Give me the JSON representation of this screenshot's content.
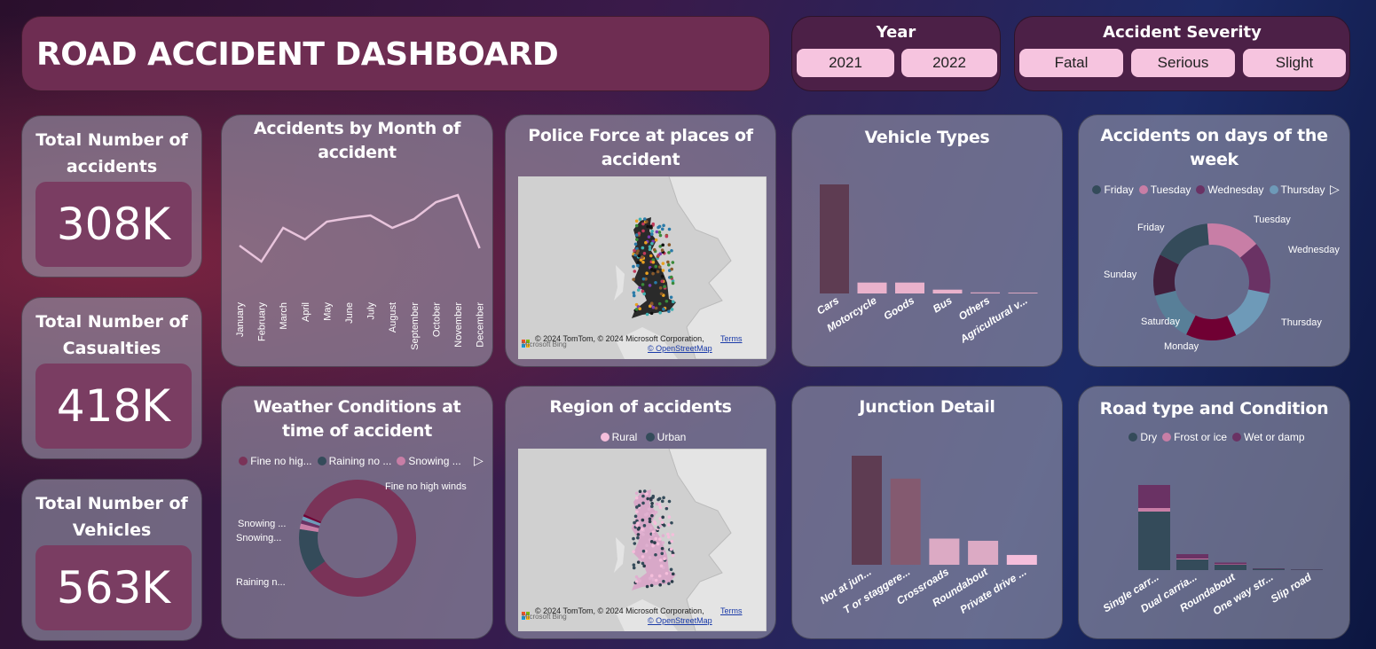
{
  "header": {
    "title": "ROAD ACCIDENT DASHBOARD"
  },
  "year_slicer": {
    "label": "Year",
    "options": [
      "2021",
      "2022"
    ]
  },
  "severity_slicer": {
    "label": "Accident Severity",
    "options": [
      "Fatal",
      "Serious",
      "Slight"
    ]
  },
  "kpis": [
    {
      "label": "Total Number of accidents",
      "value": "308K"
    },
    {
      "label": "Total Number of Casualties",
      "value": "418K"
    },
    {
      "label": "Total Number of Vehicles",
      "value": "563K"
    }
  ],
  "colors": {
    "line": "#e8c4dc",
    "dark_slate": "#344b5a",
    "pink": "#c87ea6",
    "purple": "#6a3264",
    "blue": "#6e9ab8",
    "maroon": "#700033",
    "plum": "#421e3c",
    "steel": "#587f98",
    "wine": "#7a3358",
    "light_pink": "#f5bedb"
  },
  "chart_data": [
    {
      "type": "line",
      "title": "Accidents by Month of accident",
      "categories": [
        "January",
        "February",
        "March",
        "April",
        "May",
        "June",
        "July",
        "August",
        "September",
        "October",
        "November",
        "December"
      ],
      "values": [
        24.3,
        22.5,
        26.3,
        25.0,
        27.0,
        27.4,
        27.7,
        26.3,
        27.3,
        29.2,
        30.0,
        24.0
      ],
      "grid": false
    },
    {
      "type": "bar",
      "title": "Vehicle Types",
      "categories": [
        "Cars",
        "Motorcycle",
        "Goods",
        "Bus",
        "Others",
        "Agricultural v..."
      ],
      "values": [
        100,
        10,
        10,
        3.5,
        1,
        0.8
      ],
      "colors": [
        "#5e3c52",
        "#eab2cc",
        "#eab2cc",
        "#eab2cc",
        "#d9a6c0",
        "#d9a6c0"
      ]
    },
    {
      "type": "pie",
      "title": "Accidents on days of the week",
      "legend": [
        "Friday",
        "Tuesday",
        "Wednesday",
        "Thursday"
      ],
      "slices": [
        {
          "label": "Tuesday",
          "value": 15,
          "color": "#c87ea6"
        },
        {
          "label": "Wednesday",
          "value": 14.5,
          "color": "#6a3264"
        },
        {
          "label": "Thursday",
          "value": 15,
          "color": "#6e9ab8"
        },
        {
          "label": "Monday",
          "value": 14,
          "color": "#700033"
        },
        {
          "label": "Saturday",
          "value": 14,
          "color": "#587f98"
        },
        {
          "label": "Sunday",
          "value": 11.5,
          "color": "#421e3c"
        },
        {
          "label": "Friday",
          "value": 16,
          "color": "#344b5a"
        }
      ]
    },
    {
      "type": "pie",
      "title": "Weather Conditions at time of accident",
      "legend": [
        "Fine no hig...",
        "Raining no ...",
        "Snowing ..."
      ],
      "slices": [
        {
          "label": "Fine no high winds",
          "value": 81,
          "color": "#7a3358"
        },
        {
          "label": "Raining n...",
          "value": 12,
          "color": "#344b5a"
        },
        {
          "label": "Snowing...",
          "value": 1.5,
          "color": "#c87ea6"
        },
        {
          "label": "",
          "value": 1,
          "color": "#6a3264"
        },
        {
          "label": "Snowing ...",
          "value": 1,
          "color": "#6e9ab8"
        },
        {
          "label": "",
          "value": 0.6,
          "color": "#700033"
        }
      ]
    },
    {
      "type": "bar",
      "title": "Junction Detail",
      "categories": [
        "Not at jun...",
        "T or staggere...",
        "Crossroads",
        "Roundabout",
        "Private drive ..."
      ],
      "values": [
        100,
        79,
        24,
        22,
        9
      ],
      "colors": [
        "#5e3c52",
        "#845a70",
        "#dcaac4",
        "#dcaac4",
        "#f5bedb"
      ]
    },
    {
      "type": "bar",
      "stacked": true,
      "title": "Road type and Condition",
      "categories": [
        "Single carr...",
        "Dual carria...",
        "Roundabout",
        "One way str...",
        "Slip road"
      ],
      "series": [
        {
          "name": "Dry",
          "values": [
            66,
            12,
            6,
            1.5,
            0.6
          ],
          "color": "#344b5a"
        },
        {
          "name": "Frost or ice",
          "values": [
            4,
            1,
            0.5,
            0,
            0
          ],
          "color": "#c87ea6"
        },
        {
          "name": "Wet or damp",
          "values": [
            26,
            5,
            2,
            0.5,
            0.3
          ],
          "color": "#6a3264"
        }
      ]
    }
  ],
  "maps": {
    "police": {
      "title": "Police Force at places of accident"
    },
    "region": {
      "title": "Region of accidents",
      "legend": [
        "Rural",
        "Urban"
      ],
      "legend_colors": [
        "#f5bedb",
        "#344b5a"
      ]
    },
    "attribution": "© 2024 TomTom, © 2024 Microsoft Corporation,",
    "terms": "Terms",
    "osm": "© OpenStreetMap",
    "bing": "Microsoft Bing"
  }
}
